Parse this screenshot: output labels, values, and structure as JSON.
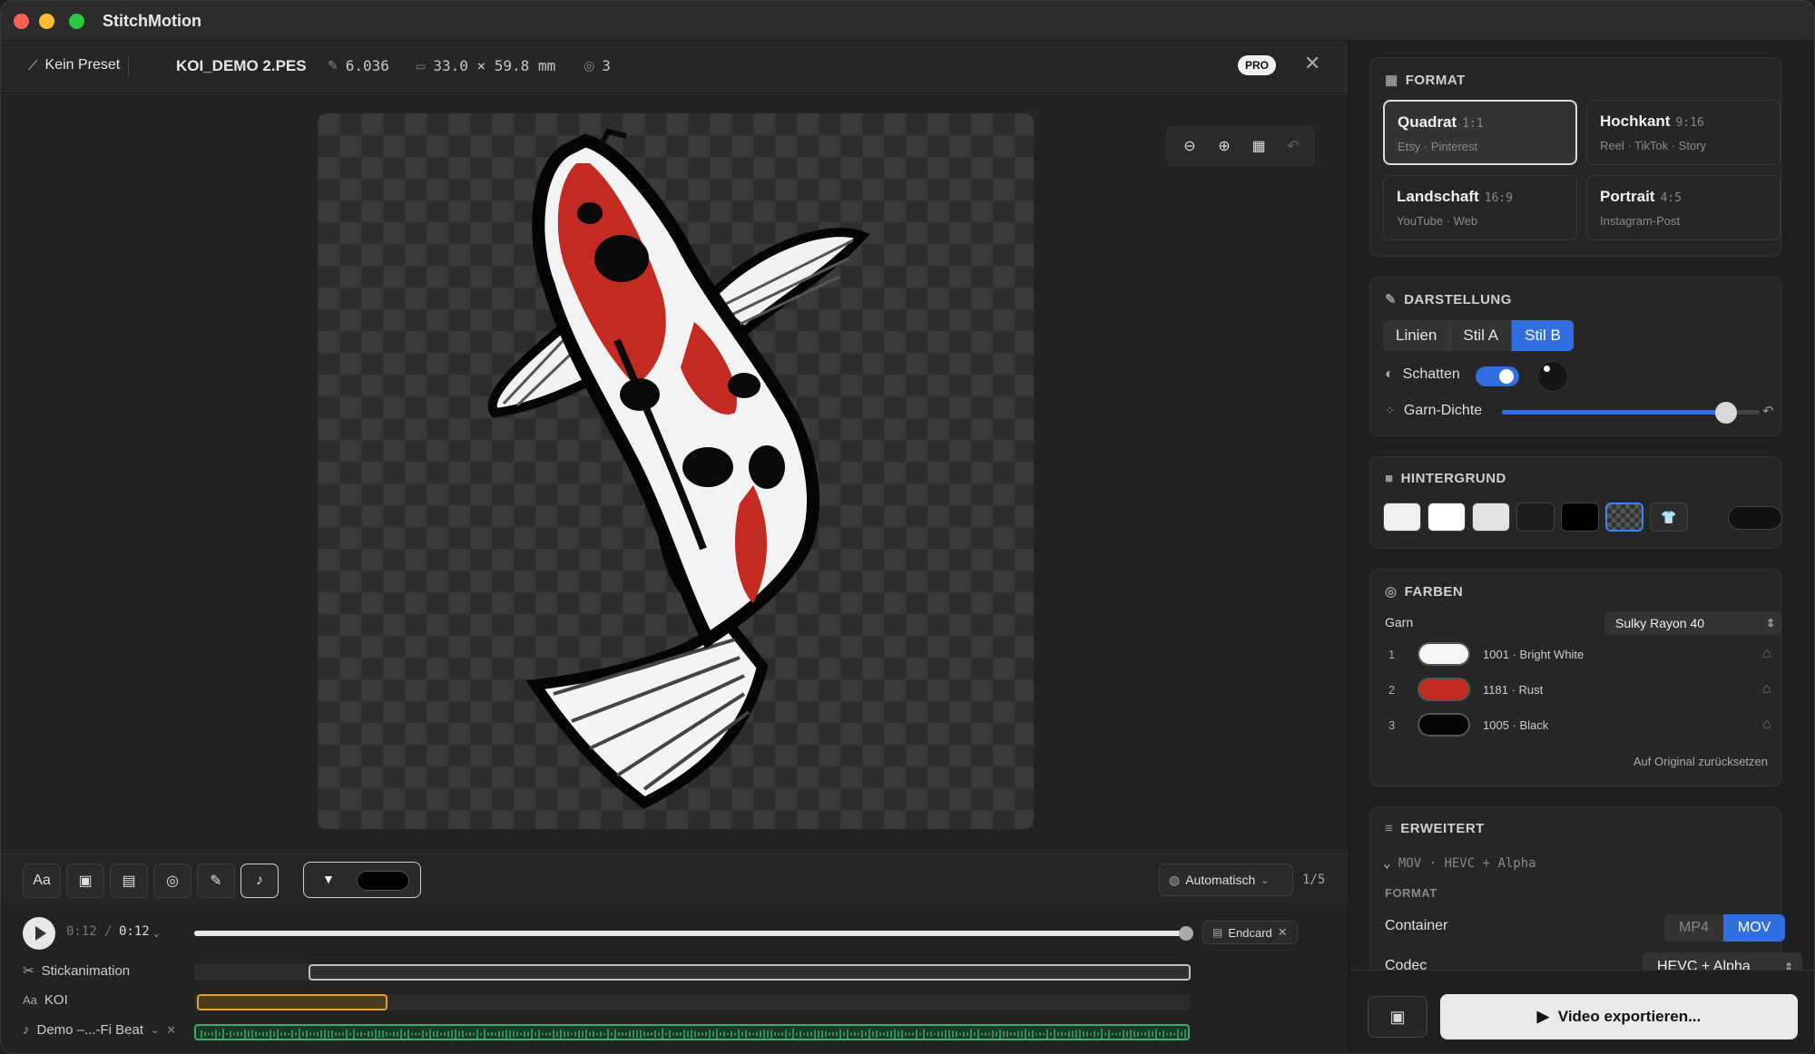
{
  "window": {
    "title": "StitchMotion"
  },
  "infobar": {
    "preset": "Kein Preset",
    "filename": "KOI_DEMO 2.PES",
    "stitches": "6.036",
    "size": "33.0 × 59.8 mm",
    "colors": "3",
    "badge": "PRO"
  },
  "toolbar": {
    "text_tool": "Aa",
    "language": "Automatisch",
    "page": "1/5"
  },
  "timeline": {
    "current_time": "0:12",
    "separator": "/",
    "total_time": "0:12",
    "progress": 1.0,
    "endcard_label": "Endcard",
    "tracks": {
      "animation": "Stickanimation",
      "text": "KOI",
      "audio": "Demo –...-Fi Beat"
    }
  },
  "panel": {
    "format": {
      "heading": "FORMAT",
      "options": [
        {
          "name": "Quadrat",
          "ratio": "1:1",
          "sub": "Etsy · Pinterest"
        },
        {
          "name": "Hochkant",
          "ratio": "9:16",
          "sub": "Reel · TikTok · Story"
        },
        {
          "name": "Landschaft",
          "ratio": "16:9",
          "sub": "YouTube · Web"
        },
        {
          "name": "Portrait",
          "ratio": "4:5",
          "sub": "Instagram-Post"
        }
      ]
    },
    "darstellung": {
      "heading": "DARSTELLUNG",
      "styles": [
        "Linien",
        "Stil A",
        "Stil B"
      ],
      "shadow_label": "Schatten",
      "density_label": "Garn-Dichte",
      "density_value": 0.87
    },
    "hintergrund": {
      "heading": "HINTERGRUND"
    },
    "farben": {
      "heading": "FARBEN",
      "garn_label": "Garn",
      "garn_value": "Sulky Rayon 40",
      "yarns": [
        {
          "num": "1",
          "label": "1001 · Bright White",
          "color": "#f5f5f5"
        },
        {
          "num": "2",
          "label": "1181 · Rust",
          "color": "#c22a22"
        },
        {
          "num": "3",
          "label": "1005 · Black",
          "color": "#050505"
        }
      ],
      "reset": "Auf Original zurücksetzen"
    },
    "erweitert": {
      "heading": "ERWEITERT",
      "summary": "MOV · HEVC + Alpha",
      "sub_heading": "FORMAT",
      "container_label": "Container",
      "container_options": [
        "MP4",
        "MOV"
      ],
      "codec_label": "Codec",
      "codec_value": "HEVC + Alpha"
    },
    "export_label": "Video exportieren..."
  },
  "colors": {
    "accent": "#2f6fe0",
    "koi_red": "#c22a22",
    "track_yellow": "#d9a23a",
    "track_green": "#3fa96c"
  }
}
